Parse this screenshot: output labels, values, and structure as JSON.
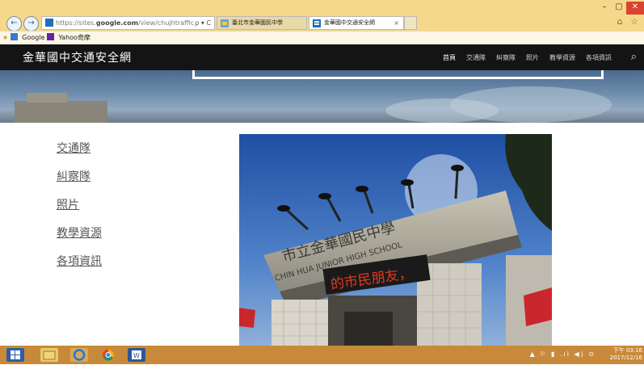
{
  "browser": {
    "url_host": "https://sites.",
    "url_domain": "google.com",
    "url_path": "/view/chujhtraffic",
    "addr_controls": "ρ ▾ C",
    "tabs": [
      {
        "title": "臺北市金華國民中學",
        "active": false
      },
      {
        "title": "金華國中交通安全網",
        "active": true
      }
    ],
    "tab_close": "×",
    "window_controls": [
      "–",
      "▢",
      "✕"
    ],
    "favorites": [
      {
        "label": "Google"
      },
      {
        "label": "Yahoo奇摩"
      }
    ],
    "right_icons": "⌂ ☆"
  },
  "site": {
    "title": "金華國中交通安全網",
    "nav": [
      {
        "label": "首頁",
        "active": true
      },
      {
        "label": "交通隊",
        "active": false
      },
      {
        "label": "糾察隊",
        "active": false
      },
      {
        "label": "照片",
        "active": false
      },
      {
        "label": "教學資源",
        "active": false
      },
      {
        "label": "各項資訊",
        "active": false
      }
    ],
    "search_icon": "⚲"
  },
  "menu": {
    "items": [
      {
        "label": "交通隊"
      },
      {
        "label": "糾察隊"
      },
      {
        "label": "照片"
      },
      {
        "label": "教學資源"
      },
      {
        "label": "各項資訊"
      }
    ]
  },
  "photo": {
    "sign_text": "市立金華國民中學",
    "sign_english": "CHIN HUA JUNIOR HIGH SCHOOL",
    "led_text": "的市民朋友，"
  },
  "taskbar": {
    "tray": "▲ ⚐ ▮ .ıl ◀) ⊙",
    "time": "下午 03:16",
    "date": "2017/12/16"
  },
  "colors": {
    "chrome": "#f5d88a",
    "site_header": "#141414",
    "taskbar": "#c88a3a",
    "led": "#e03a1e"
  }
}
